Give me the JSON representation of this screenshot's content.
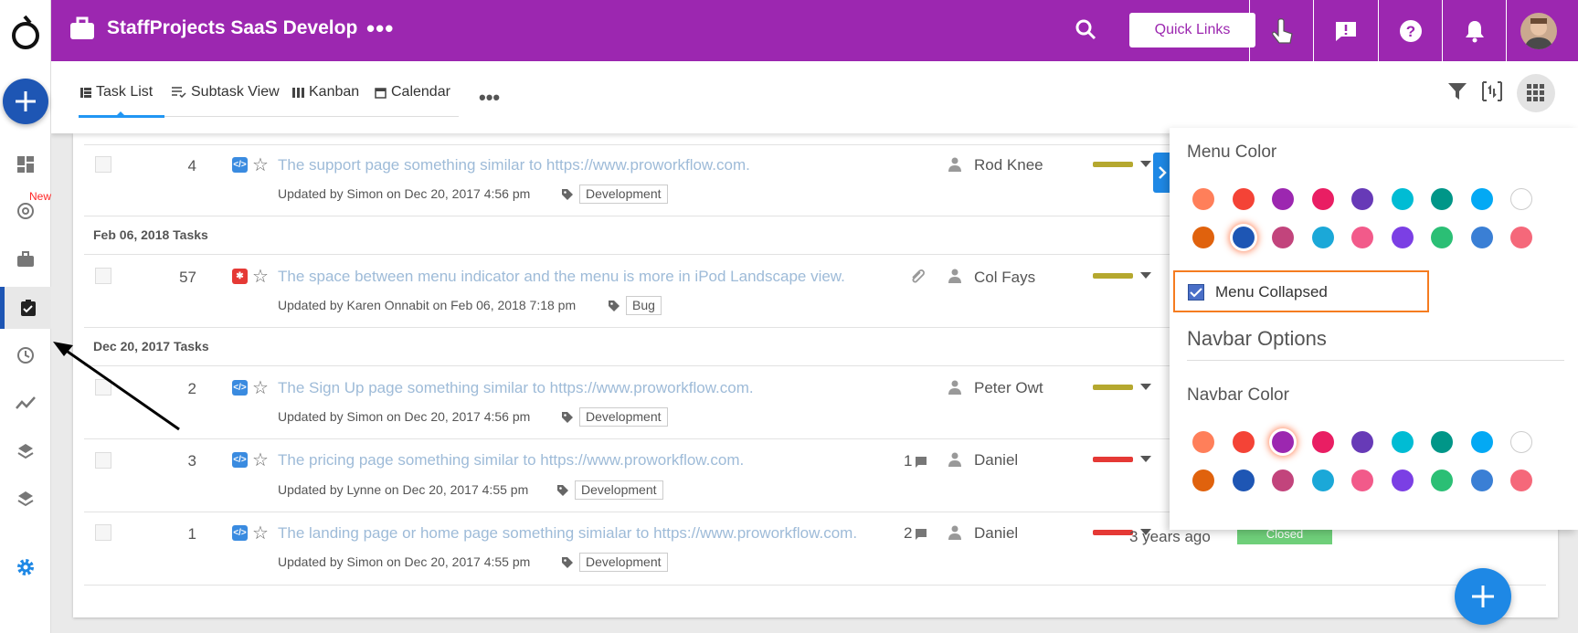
{
  "header": {
    "project_title": "StaffProjects SaaS Develop",
    "more_label": "•••",
    "quick_links": "Quick Links",
    "navbar_color": "#9c27b0"
  },
  "sidebar": {
    "new_badge": "New",
    "items": [
      {
        "icon": "dashboard-icon"
      },
      {
        "icon": "mention-icon"
      },
      {
        "icon": "briefcase-icon"
      },
      {
        "icon": "task-clipboard-icon",
        "active": true
      },
      {
        "icon": "clock-icon"
      },
      {
        "icon": "trend-icon"
      },
      {
        "icon": "layers-icon"
      },
      {
        "icon": "layers-icon"
      },
      {
        "icon": "settings-gear-icon"
      }
    ]
  },
  "tabs": [
    {
      "label": "Task List",
      "icon": "list-icon",
      "active": true
    },
    {
      "label": "Subtask View",
      "icon": "subtask-icon"
    },
    {
      "label": "Kanban",
      "icon": "kanban-icon"
    },
    {
      "label": "Calendar",
      "icon": "calendar-icon"
    }
  ],
  "tabs_more": "•••",
  "groups": [
    {
      "label": "Feb 06, 2018 Tasks"
    },
    {
      "label": "Dec 20, 2017 Tasks"
    }
  ],
  "tasks": [
    {
      "num": "4",
      "type": "code",
      "title": "The support page something similar to https://www.proworkflow.com.",
      "updated": "Updated by Simon on Dec 20, 2017 4:56 pm",
      "tag": "Development",
      "assignee": "Rod Knee",
      "priority_color": "#b5a82f",
      "comments": ""
    },
    {
      "num": "57",
      "type": "bug",
      "title": "The space between menu indicator and the menu is more in iPod Landscape view.",
      "updated": "Updated by Karen Onnabit on Feb 06, 2018 7:18 pm",
      "tag": "Bug",
      "assignee": "Col Fays",
      "priority_color": "#b5a82f",
      "comments": ""
    },
    {
      "num": "2",
      "type": "code",
      "title": "The Sign Up page something similar to https://www.proworkflow.com.",
      "updated": "Updated by Simon on Dec 20, 2017 4:56 pm",
      "tag": "Development",
      "assignee": "Peter Owt",
      "priority_color": "#b5a82f",
      "comments": ""
    },
    {
      "num": "3",
      "type": "code",
      "title": "The pricing page something similar to https://www.proworkflow.com.",
      "updated": "Updated by Lynne on Dec 20, 2017 4:55 pm",
      "tag": "Development",
      "assignee": "Daniel",
      "priority_color": "#e53935",
      "comments": "1"
    },
    {
      "num": "1",
      "type": "code",
      "title": "The landing page or home page something simialar to https://www.proworkflow.com.",
      "updated": "Updated by Simon on Dec 20, 2017 4:55 pm",
      "tag": "Development",
      "assignee": "Daniel",
      "priority_color": "#e53935",
      "comments": "2",
      "time_ago": "3 years ago",
      "status": "Closed"
    }
  ],
  "panel": {
    "menu_color_title": "Menu Color",
    "menu_collapsed_label": "Menu Collapsed",
    "menu_collapsed_checked": true,
    "navbar_options_title": "Navbar Options",
    "navbar_color_title": "Navbar Color",
    "menu_colors": [
      "#ff7f5a",
      "#f44336",
      "#9c27b0",
      "#e91e63",
      "#673ab7",
      "#00bcd4",
      "#009688",
      "#03a9f4",
      "#ffffff",
      "#e0620d",
      "#1e56b4",
      "#c2447c",
      "#1ba8d8",
      "#f25a8a",
      "#7b3fe4",
      "#2bbf75",
      "#3a7fd5",
      "#f5687a"
    ],
    "menu_selected": 10,
    "navbar_colors": [
      "#ff7f5a",
      "#f44336",
      "#9c27b0",
      "#e91e63",
      "#673ab7",
      "#00bcd4",
      "#009688",
      "#03a9f4",
      "#ffffff",
      "#e0620d",
      "#1e56b4",
      "#c2447c",
      "#1ba8d8",
      "#f25a8a",
      "#7b3fe4",
      "#2bbf75",
      "#3a7fd5",
      "#f5687a"
    ],
    "navbar_selected": 2
  }
}
